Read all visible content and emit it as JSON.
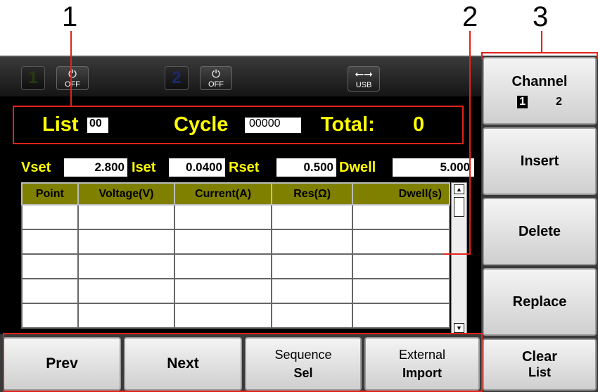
{
  "callouts": [
    "1",
    "2",
    "3"
  ],
  "status_bar": {
    "channel_1": "1",
    "channel_1_power": "OFF",
    "channel_2": "2",
    "channel_2_power": "OFF",
    "usb": "USB"
  },
  "list_header": {
    "list_label": "List",
    "list_value": "00",
    "cycle_label": "Cycle",
    "cycle_value": "00000",
    "total_label": "Total:",
    "total_value": "0"
  },
  "params": {
    "vset_label": "Vset",
    "vset_value": "2.800",
    "iset_label": "Iset",
    "iset_value": "0.0400",
    "rset_label": "Rset",
    "rset_value": "0.500",
    "dwell_label": "Dwell",
    "dwell_value": "5.000"
  },
  "table": {
    "columns": [
      "Point",
      "Voltage(V)",
      "Current(A)",
      "Res(Ω)",
      "Dwell(s)"
    ],
    "rows": [
      [
        "",
        "",
        "",
        "",
        ""
      ],
      [
        "",
        "",
        "",
        "",
        ""
      ],
      [
        "",
        "",
        "",
        "",
        ""
      ],
      [
        "",
        "",
        "",
        "",
        ""
      ],
      [
        "",
        "",
        "",
        "",
        ""
      ]
    ]
  },
  "softkeys": {
    "prev": "Prev",
    "next": "Next",
    "sequence_line1": "Sequence",
    "sequence_line2": "Sel",
    "external_line1": "External",
    "external_line2": "Import"
  },
  "sidekeys": {
    "channel": "Channel",
    "channel_1": "1",
    "channel_2": "2",
    "insert": "Insert",
    "delete": "Delete",
    "replace": "Replace",
    "clear_line1": "Clear",
    "clear_line2": "List"
  },
  "colors": {
    "label_yellow": "#ffff00",
    "header_olive": "#808000",
    "callout_red": "#e2231a"
  }
}
